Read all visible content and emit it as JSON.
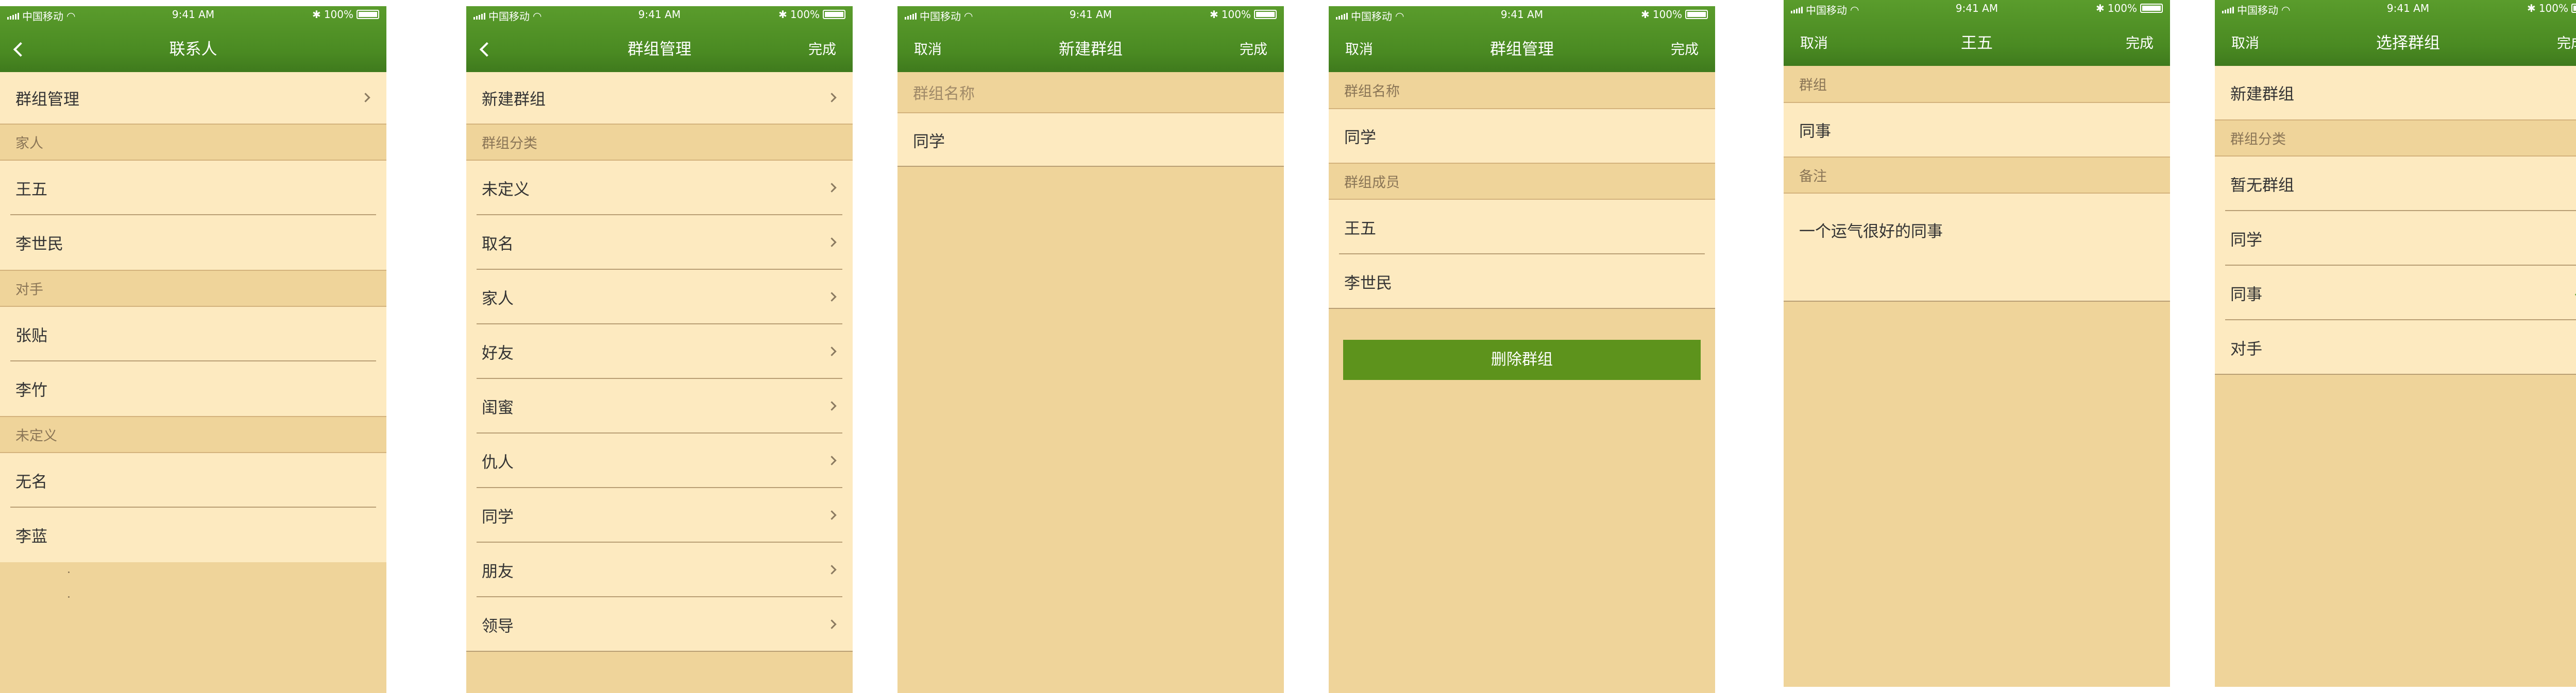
{
  "status": {
    "carrier": "中国移动",
    "time": "9:41 AM",
    "battery": "100%"
  },
  "colors": {
    "nav_green": "#4a8a22",
    "cell_bg": "#fdeac0",
    "page_bg": "#efd49a",
    "button_green": "#5d931c"
  },
  "screens": [
    {
      "title": "联系人",
      "items": [
        {
          "label": "群组管理"
        },
        {
          "label": "家人"
        },
        {
          "label": "王五"
        },
        {
          "label": "李世民"
        },
        {
          "label": "对手"
        },
        {
          "label": "张贴"
        },
        {
          "label": "李竹"
        },
        {
          "label": "未定义"
        },
        {
          "label": "无名"
        },
        {
          "label": "李蓝"
        }
      ]
    },
    {
      "title": "群组管理",
      "right": "完成",
      "items": [
        {
          "label": "新建群组"
        },
        {
          "label": "群组分类"
        },
        {
          "label": "未定义"
        },
        {
          "label": "取名"
        },
        {
          "label": "家人"
        },
        {
          "label": "好友"
        },
        {
          "label": "闺蜜"
        },
        {
          "label": "仇人"
        },
        {
          "label": "同学"
        },
        {
          "label": "朋友"
        },
        {
          "label": "领导"
        }
      ]
    },
    {
      "title": "新建群组",
      "left": "取消",
      "right": "完成",
      "items": [
        {
          "label": "群组名称"
        },
        {
          "label": "同学"
        }
      ]
    },
    {
      "title": "群组管理",
      "left": "取消",
      "right": "完成",
      "items": [
        {
          "label": "群组名称"
        },
        {
          "label": "同学"
        },
        {
          "label": "群组成员"
        },
        {
          "label": "王五"
        },
        {
          "label": "李世民"
        }
      ],
      "button": "删除群组"
    },
    {
      "title": "王五",
      "left": "取消",
      "right": "完成",
      "items": [
        {
          "label": "群组"
        },
        {
          "label": "同事"
        },
        {
          "label": "备注"
        },
        {
          "label": "一个运气很好的同事"
        }
      ]
    },
    {
      "title": "选择群组",
      "left": "取消",
      "right": "完成",
      "items": [
        {
          "label": "新建群组"
        },
        {
          "label": "群组分类"
        },
        {
          "label": "暂无群组"
        },
        {
          "label": "同学"
        },
        {
          "label": "同事"
        },
        {
          "label": "对手"
        }
      ]
    }
  ]
}
